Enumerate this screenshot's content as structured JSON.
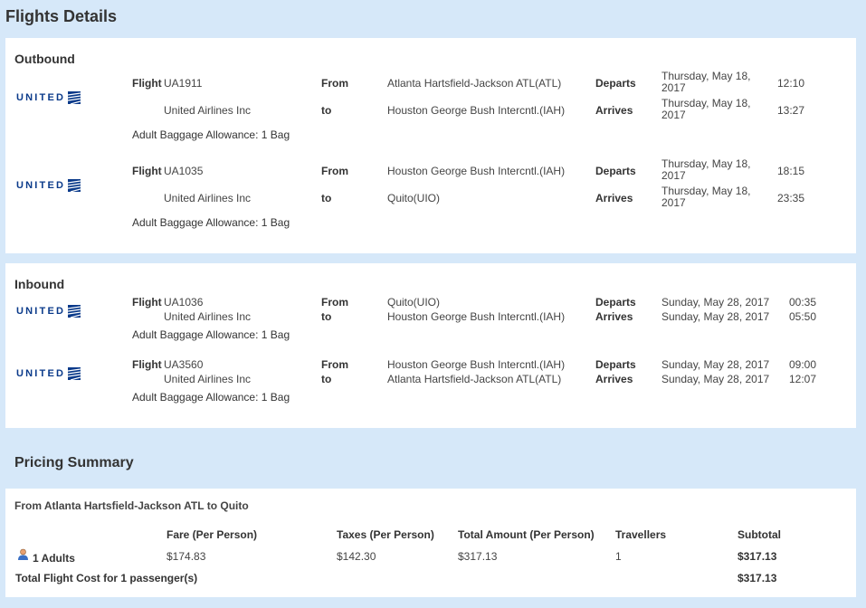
{
  "page": {
    "title": "Flights Details"
  },
  "outbound": {
    "title": "Outbound",
    "flights": [
      {
        "airline_logo": "UNITED",
        "flight_label": "Flight",
        "flight_no": "UA1911",
        "airline": "United Airlines Inc",
        "from_label": "From",
        "to_label": "to",
        "from": "Atlanta Hartsfield-Jackson ATL(ATL)",
        "to": "Houston George Bush Intercntl.(IAH)",
        "departs_label": "Departs",
        "arrives_label": "Arrives",
        "depart_date": "Thursday, May 18, 2017",
        "depart_time": "12:10",
        "arrive_date": "Thursday, May 18, 2017",
        "arrive_time": "13:27",
        "baggage": "Adult Baggage Allowance: 1 Bag"
      },
      {
        "airline_logo": "UNITED",
        "flight_label": "Flight",
        "flight_no": "UA1035",
        "airline": "United Airlines Inc",
        "from_label": "From",
        "to_label": "to",
        "from": "Houston George Bush Intercntl.(IAH)",
        "to": "Quito(UIO)",
        "departs_label": "Departs",
        "arrives_label": "Arrives",
        "depart_date": "Thursday, May 18, 2017",
        "depart_time": "18:15",
        "arrive_date": "Thursday, May 18, 2017",
        "arrive_time": "23:35",
        "baggage": "Adult Baggage Allowance: 1 Bag"
      }
    ]
  },
  "inbound": {
    "title": "Inbound",
    "flights": [
      {
        "airline_logo": "UNITED",
        "flight_label": "Flight",
        "flight_no": "UA1036",
        "airline": "United Airlines Inc",
        "from_label": "From",
        "to_label": "to",
        "from": "Quito(UIO)",
        "to": "Houston George Bush Intercntl.(IAH)",
        "departs_label": "Departs",
        "arrives_label": "Arrives",
        "depart_date": "Sunday, May 28, 2017",
        "depart_time": "00:35",
        "arrive_date": "Sunday, May 28, 2017",
        "arrive_time": "05:50",
        "baggage": "Adult Baggage Allowance: 1 Bag"
      },
      {
        "airline_logo": "UNITED",
        "flight_label": "Flight",
        "flight_no": "UA3560",
        "airline": "United Airlines Inc",
        "from_label": "From",
        "to_label": "to",
        "from": "Houston George Bush Intercntl.(IAH)",
        "to": "Atlanta Hartsfield-Jackson ATL(ATL)",
        "departs_label": "Departs",
        "arrives_label": "Arrives",
        "depart_date": "Sunday, May 28, 2017",
        "depart_time": "09:00",
        "arrive_date": "Sunday, May 28, 2017",
        "arrive_time": "12:07",
        "baggage": "Adult Baggage Allowance: 1 Bag"
      }
    ]
  },
  "pricing": {
    "title": "Pricing Summary",
    "route": "From Atlanta Hartsfield-Jackson ATL to Quito",
    "headers": {
      "fare": "Fare (Per Person)",
      "taxes": "Taxes (Per Person)",
      "total": "Total Amount (Per Person)",
      "travellers": "Travellers",
      "subtotal": "Subtotal"
    },
    "row": {
      "passenger_icon": "person-icon",
      "passengers": "1 Adults",
      "fare": "$174.83",
      "taxes": "$142.30",
      "total": "$317.13",
      "travellers": "1",
      "subtotal": "$317.13"
    },
    "total_label": "Total Flight Cost for 1 passenger(s)",
    "total_value": "$317.13"
  },
  "colors": {
    "background": "#d6e8f9",
    "panel": "#ffffff",
    "logo_blue": "#0a3a8a"
  }
}
